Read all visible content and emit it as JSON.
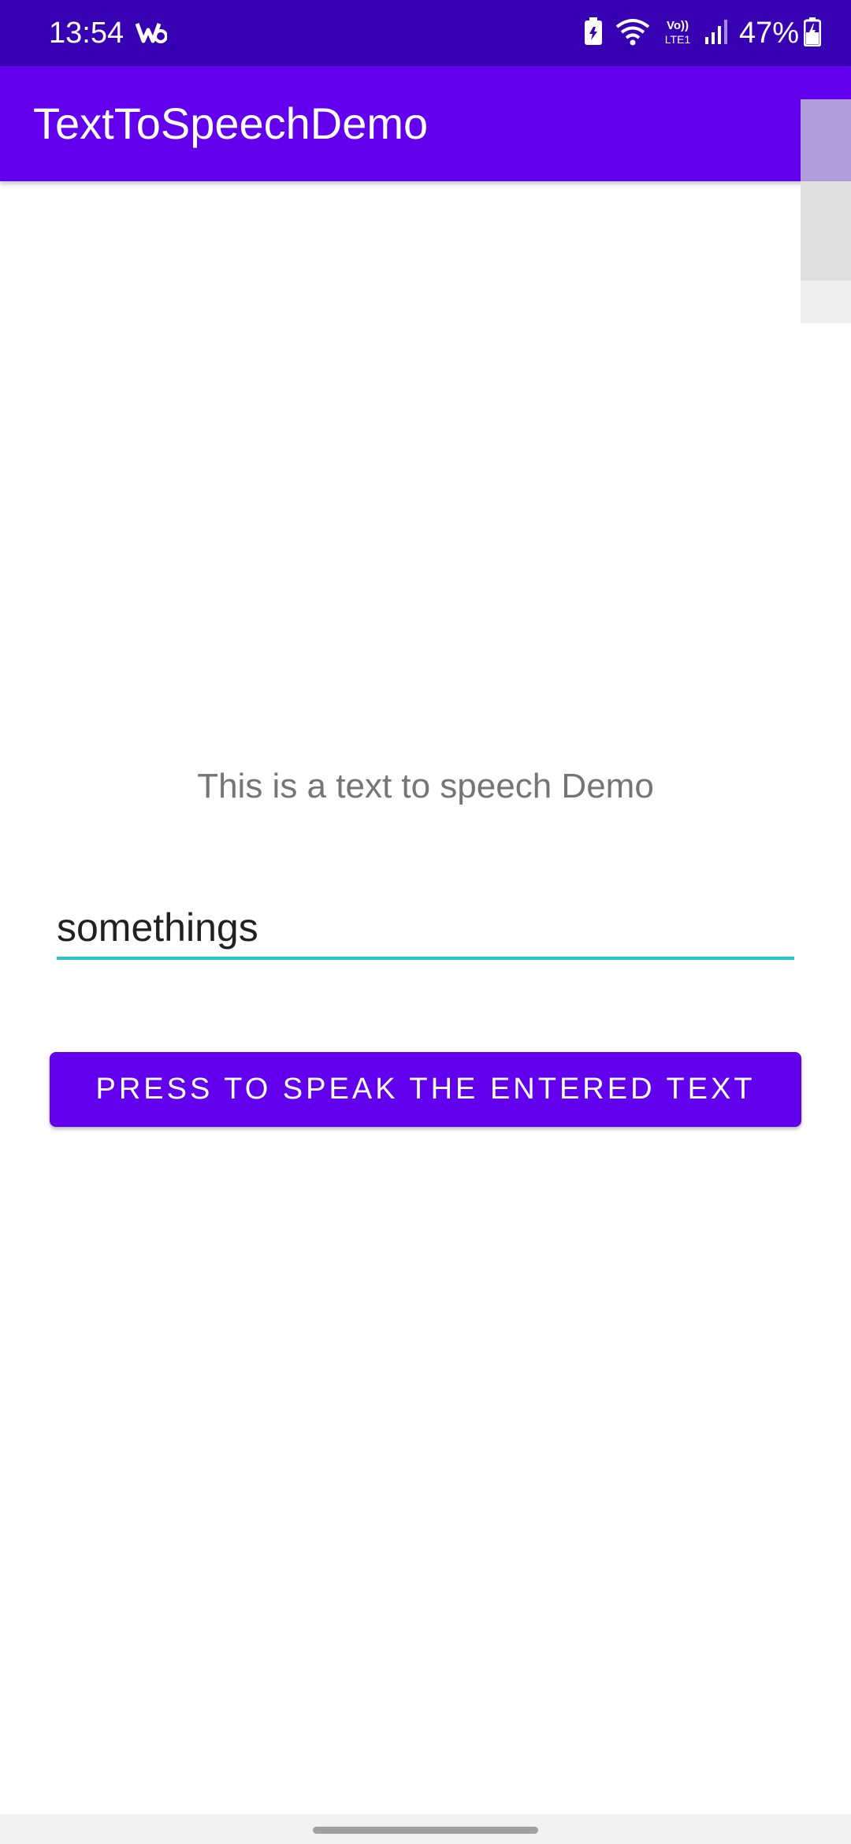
{
  "status_bar": {
    "time": "13:54",
    "battery_percent": "47%",
    "network_label": "Vo) LTE1",
    "icons": [
      "app-notification-icon",
      "battery-saver-icon",
      "wifi-icon",
      "volte-icon",
      "signal-icon",
      "battery-charging-icon"
    ]
  },
  "app_bar": {
    "title": "TextToSpeechDemo"
  },
  "main": {
    "caption": "This is a text to speech Demo",
    "input_value": "somethings",
    "speak_button_label": "PRESS TO SPEAK THE ENTERED TEXT"
  },
  "colors": {
    "status_bar": "#3700b3",
    "primary": "#6200ee",
    "input_underline": "#26c6c6",
    "caption_text": "#757575"
  }
}
